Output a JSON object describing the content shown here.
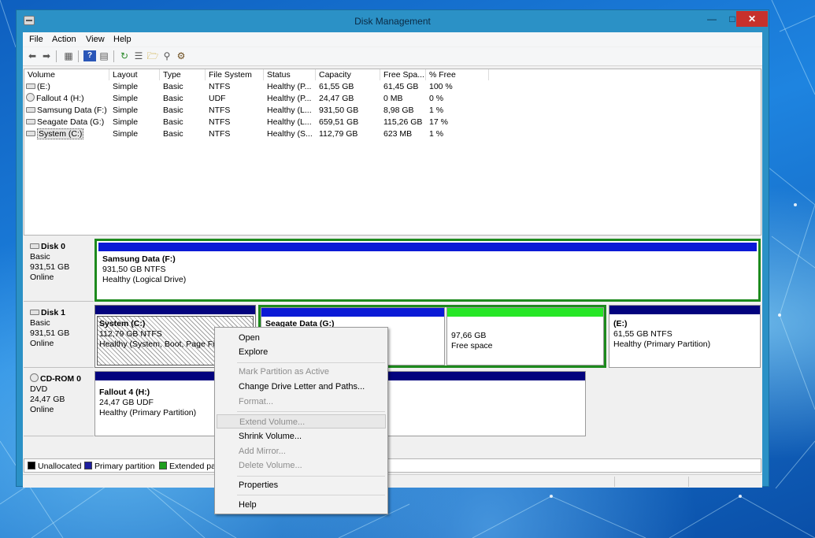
{
  "window": {
    "title": "Disk Management"
  },
  "menubar": [
    "File",
    "Action",
    "View",
    "Help"
  ],
  "toolbar": {
    "icons": [
      "back-arrow-icon",
      "forward-arrow-icon",
      "details-view-icon",
      "help-icon",
      "list-view-icon",
      "refresh-icon",
      "properties-icon",
      "open-folder-icon",
      "search-icon",
      "settings-icon"
    ]
  },
  "volume_list": {
    "columns": [
      "Volume",
      "Layout",
      "Type",
      "File System",
      "Status",
      "Capacity",
      "Free Spa...",
      "% Free"
    ],
    "rows": [
      {
        "volume": "(E:)",
        "layout": "Simple",
        "type": "Basic",
        "fs": "NTFS",
        "status": "Healthy (P...",
        "capacity": "61,55 GB",
        "free": "61,45 GB",
        "pct": "100 %",
        "icon": "drive-icon"
      },
      {
        "volume": "Fallout 4 (H:)",
        "layout": "Simple",
        "type": "Basic",
        "fs": "UDF",
        "status": "Healthy (P...",
        "capacity": "24,47 GB",
        "free": "0 MB",
        "pct": "0 %",
        "icon": "disc-icon"
      },
      {
        "volume": "Samsung Data (F:)",
        "layout": "Simple",
        "type": "Basic",
        "fs": "NTFS",
        "status": "Healthy (L...",
        "capacity": "931,50 GB",
        "free": "8,98 GB",
        "pct": "1 %",
        "icon": "drive-icon"
      },
      {
        "volume": "Seagate Data (G:)",
        "layout": "Simple",
        "type": "Basic",
        "fs": "NTFS",
        "status": "Healthy (L...",
        "capacity": "659,51 GB",
        "free": "115,26 GB",
        "pct": "17 %",
        "icon": "drive-icon"
      },
      {
        "volume": "System (C:)",
        "layout": "Simple",
        "type": "Basic",
        "fs": "NTFS",
        "status": "Healthy (S...",
        "capacity": "112,79 GB",
        "free": "623 MB",
        "pct": "1 %",
        "icon": "drive-icon"
      }
    ]
  },
  "disks": [
    {
      "name": "Disk 0",
      "type": "Basic",
      "size": "931,51 GB",
      "state": "Online"
    },
    {
      "name": "Disk 1",
      "type": "Basic",
      "size": "931,51 GB",
      "state": "Online"
    },
    {
      "name": "CD-ROM 0",
      "type": "DVD",
      "size": "24,47 GB",
      "state": "Online"
    }
  ],
  "partitions": {
    "samsung": {
      "name": "Samsung Data  (F:)",
      "line1": "931,50 GB NTFS",
      "line2": "Healthy (Logical Drive)"
    },
    "system": {
      "name": "System  (C:)",
      "line1": "112,79 GB NTFS",
      "line2": "Healthy (System, Boot, Page File,"
    },
    "seagate": {
      "name": "Seagate Data  (G:)"
    },
    "free": {
      "line1": "97,66 GB",
      "line2": "Free space"
    },
    "e": {
      "name": "(E:)",
      "line1": "61,55 GB NTFS",
      "line2": "Healthy (Primary Partition)"
    },
    "fallout": {
      "name": "Fallout 4  (H:)",
      "line1": "24,47 GB UDF",
      "line2": "Healthy (Primary Partition)"
    }
  },
  "legend": [
    {
      "label": "Unallocated",
      "color": "#000000"
    },
    {
      "label": "Primary partition",
      "color": "#1f1f9e"
    },
    {
      "label": "Extended par",
      "color": "#1f9e1f"
    }
  ],
  "colors": {
    "primary_bar": "#03037e",
    "logical_bar": "#0b1ad6",
    "free_bar": "#26e626",
    "extended_border": "#1d8a1d"
  },
  "context_menu": {
    "items": [
      {
        "label": "Open",
        "enabled": true
      },
      {
        "label": "Explore",
        "enabled": true
      },
      {
        "label": "Mark Partition as Active",
        "enabled": false
      },
      {
        "label": "Change Drive Letter and Paths...",
        "enabled": true
      },
      {
        "label": "Format...",
        "enabled": false
      },
      {
        "label": "Extend Volume...",
        "enabled": false
      },
      {
        "label": "Shrink Volume...",
        "enabled": true
      },
      {
        "label": "Add Mirror...",
        "enabled": false
      },
      {
        "label": "Delete Volume...",
        "enabled": false
      },
      {
        "label": "Properties",
        "enabled": true
      },
      {
        "label": "Help",
        "enabled": true
      }
    ]
  }
}
